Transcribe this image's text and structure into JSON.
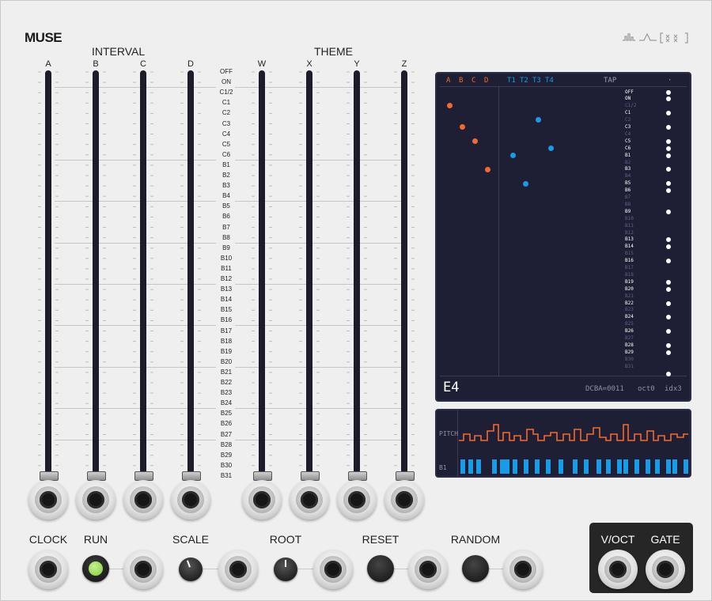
{
  "module": {
    "name": "MUSE"
  },
  "interval": {
    "title": "INTERVAL",
    "columns": [
      "A",
      "B",
      "C",
      "D"
    ]
  },
  "theme": {
    "title": "THEME",
    "columns": [
      "W",
      "X",
      "Y",
      "Z"
    ]
  },
  "steps": [
    "OFF",
    "ON",
    "C1/2",
    "C1",
    "C2",
    "C3",
    "C4",
    "C5",
    "C6",
    "B1",
    "B2",
    "B3",
    "B4",
    "B5",
    "B6",
    "B7",
    "B8",
    "B9",
    "B10",
    "B11",
    "B12",
    "B13",
    "B14",
    "B15",
    "B16",
    "B17",
    "B18",
    "B19",
    "B20",
    "B21",
    "B22",
    "B23",
    "B24",
    "B25",
    "B26",
    "B27",
    "B28",
    "B29",
    "B30",
    "B31"
  ],
  "bottom": {
    "clock": "CLOCK",
    "run": "RUN",
    "scale": "SCALE",
    "root": "ROOT",
    "reset": "RESET",
    "random": "RANDOM",
    "voct": "V/OCT",
    "gate": "GATE"
  },
  "display": {
    "header_interval": [
      "A",
      "B",
      "C",
      "D"
    ],
    "header_theme": [
      "T1",
      "T2",
      "T3",
      "T4"
    ],
    "tap_header": "TAP",
    "tap_active": [
      true,
      true,
      false,
      true,
      false,
      true,
      false,
      true,
      true,
      true,
      false,
      true,
      false,
      true,
      true,
      false,
      false,
      true,
      false,
      false,
      false,
      true,
      true,
      false,
      true,
      false,
      false,
      true,
      true,
      false,
      true,
      false,
      true,
      false,
      true,
      false,
      true,
      true,
      false,
      false,
      true
    ],
    "note": "E4",
    "status": [
      "DCBA=0011",
      "oct0",
      "idx3"
    ],
    "colors": {
      "interval": "#f26a2e",
      "theme": "#1a9be8",
      "tap": "#ffffff"
    }
  },
  "scope": {
    "pitch_label": "PITCH",
    "gate_label": "B1",
    "colors": {
      "pitch": "#f26a2e",
      "gate": "#1a9be8"
    }
  }
}
